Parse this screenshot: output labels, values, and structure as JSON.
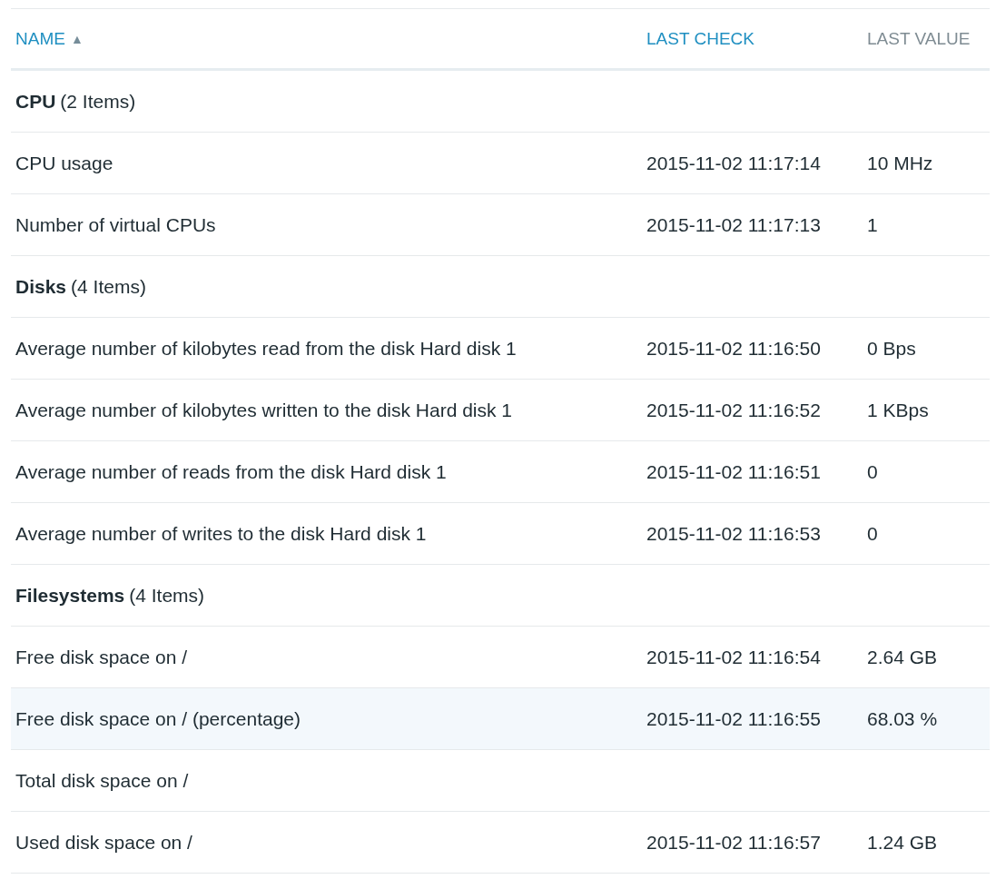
{
  "table": {
    "columns": [
      {
        "label": "NAME",
        "sortable": true,
        "sort_arrow": "▲"
      },
      {
        "label": "LAST CHECK",
        "sortable": true
      },
      {
        "label": "LAST VALUE",
        "sortable": false
      }
    ],
    "rows": [
      {
        "kind": "group",
        "name": "CPU",
        "count": "(2 Items)"
      },
      {
        "kind": "item",
        "name": "CPU usage",
        "last_check": "2015-11-02 11:17:14",
        "last_value": "10 MHz",
        "highlighted": false
      },
      {
        "kind": "item",
        "name": "Number of virtual CPUs",
        "last_check": "2015-11-02 11:17:13",
        "last_value": "1",
        "highlighted": false
      },
      {
        "kind": "group",
        "name": "Disks",
        "count": "(4 Items)"
      },
      {
        "kind": "item",
        "name": "Average number of kilobytes read from the disk Hard disk 1",
        "last_check": "2015-11-02 11:16:50",
        "last_value": "0 Bps",
        "highlighted": false
      },
      {
        "kind": "item",
        "name": "Average number of kilobytes written to the disk Hard disk 1",
        "last_check": "2015-11-02 11:16:52",
        "last_value": "1 KBps",
        "highlighted": false
      },
      {
        "kind": "item",
        "name": "Average number of reads from the disk Hard disk 1",
        "last_check": "2015-11-02 11:16:51",
        "last_value": "0",
        "highlighted": false
      },
      {
        "kind": "item",
        "name": "Average number of writes to the disk Hard disk 1",
        "last_check": "2015-11-02 11:16:53",
        "last_value": "0",
        "highlighted": false
      },
      {
        "kind": "group",
        "name": "Filesystems",
        "count": "(4 Items)"
      },
      {
        "kind": "item",
        "name": "Free disk space on /",
        "last_check": "2015-11-02 11:16:54",
        "last_value": "2.64 GB",
        "highlighted": false
      },
      {
        "kind": "item",
        "name": "Free disk space on / (percentage)",
        "last_check": "2015-11-02 11:16:55",
        "last_value": "68.03 %",
        "highlighted": true
      },
      {
        "kind": "item",
        "name": "Total disk space on /",
        "highlighted": false
      },
      {
        "kind": "item",
        "name": "Used disk space on /",
        "last_check": "2015-11-02 11:16:57",
        "last_value": "1.24 GB",
        "highlighted": false
      }
    ]
  }
}
